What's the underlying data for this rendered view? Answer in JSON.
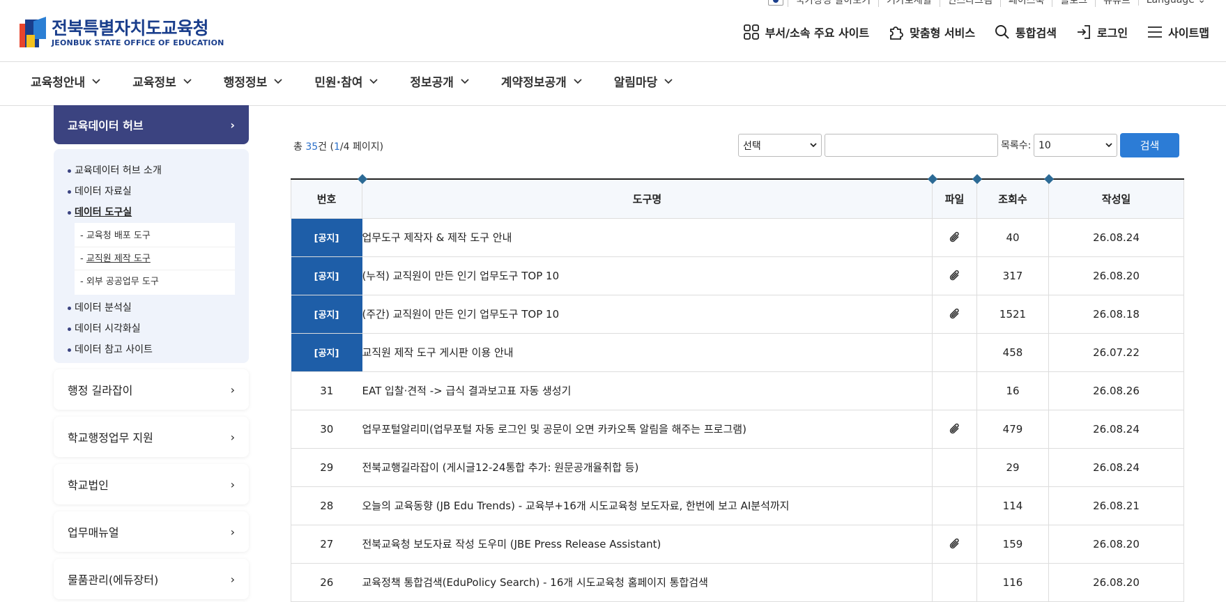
{
  "util_links": [
    "국가상징 알아보기",
    "기가로세월",
    "인스타그램",
    "페이스북",
    "블로그",
    "유튜브",
    "Language"
  ],
  "logo": {
    "kr": "전북특별자치도교육청",
    "en": "JEONBUK STATE OFFICE OF EDUCATION"
  },
  "header_links": [
    "부서/소속 주요 사이트",
    "맞춤형 서비스",
    "통합검색",
    "로그인",
    "사이트맵"
  ],
  "gnb": [
    "교육청안내",
    "교육정보",
    "행정정보",
    "민원·참여",
    "정보공개",
    "계약정보공개",
    "알림마당"
  ],
  "sidebar": {
    "active": "교육데이터 허브",
    "sub_items": [
      {
        "label": "교육데이터 허브 소개"
      },
      {
        "label": "데이터 자료실"
      },
      {
        "label": "데이터 도구실",
        "children": [
          "교육청 배포 도구",
          "교직원 제작 도구",
          "외부 공공업무 도구"
        ]
      },
      {
        "label": "데이터 분석실"
      },
      {
        "label": "데이터 시각화실"
      },
      {
        "label": "데이터 참고 사이트"
      }
    ],
    "sections": [
      "행정 길라잡이",
      "학교행정업무 지원",
      "학교법인",
      "업무매뉴얼",
      "물품관리(에듀장터)"
    ]
  },
  "board": {
    "total_prefix": "총 ",
    "total_count": "35",
    "total_mid": "건 (",
    "page_current": "1",
    "page_rest": "/4 페이지)",
    "search_select": "선택",
    "keyword_value": "",
    "list_count_label": "목록수:",
    "list_count_value": "10",
    "search_button": "검색",
    "columns": [
      "번호",
      "도구명",
      "파일",
      "조회수",
      "작성일"
    ],
    "rows": [
      {
        "no": "[공지]",
        "notice": true,
        "title": "업무도구 제작자 & 제작 도구 안내",
        "file": true,
        "views": "40",
        "date": "26.08.24"
      },
      {
        "no": "[공지]",
        "notice": true,
        "title": "(누적) 교직원이 만든 인기 업무도구 TOP 10",
        "file": true,
        "views": "317",
        "date": "26.08.20"
      },
      {
        "no": "[공지]",
        "notice": true,
        "title": "(주간) 교직원이 만든 인기 업무도구 TOP 10",
        "file": true,
        "views": "1521",
        "date": "26.08.18"
      },
      {
        "no": "[공지]",
        "notice": true,
        "title": "교직원 제작 도구 게시판 이용 안내",
        "file": false,
        "views": "458",
        "date": "26.07.22"
      },
      {
        "no": "31",
        "notice": false,
        "title": "EAT 입찰·견적 -> 급식 결과보고표 자동 생성기",
        "file": false,
        "views": "16",
        "date": "26.08.26"
      },
      {
        "no": "30",
        "notice": false,
        "title": "업무포털알리미(업무포털 자동 로그인 및 공문이 오면 카카오톡 알림을 해주는 프로그램)",
        "file": true,
        "views": "479",
        "date": "26.08.24"
      },
      {
        "no": "29",
        "notice": false,
        "title": "전북교행길라잡이 (게시글12-24통합 추가: 원문공개율취합 등)",
        "file": false,
        "views": "29",
        "date": "26.08.24"
      },
      {
        "no": "28",
        "notice": false,
        "title": "오늘의 교육동향 (JB Edu Trends) - 교육부+16개 시도교육청 보도자료, 한번에 보고 AI분석까지",
        "file": false,
        "views": "114",
        "date": "26.08.21"
      },
      {
        "no": "27",
        "notice": false,
        "title": "전북교육청 보도자료 작성 도우미 (JBE Press Release Assistant)",
        "file": true,
        "views": "159",
        "date": "26.08.20"
      },
      {
        "no": "26",
        "notice": false,
        "title": "교육정책 통합검색(EduPolicy Search) - 16개 시도교육청 홈페이지 통합검색",
        "file": false,
        "views": "116",
        "date": "26.08.20"
      }
    ]
  },
  "colors": {
    "primary": "#1a3e8c",
    "sidebar_active": "#3b4380",
    "notice_bg": "#1e5ea8",
    "button": "#2c7cd6"
  }
}
